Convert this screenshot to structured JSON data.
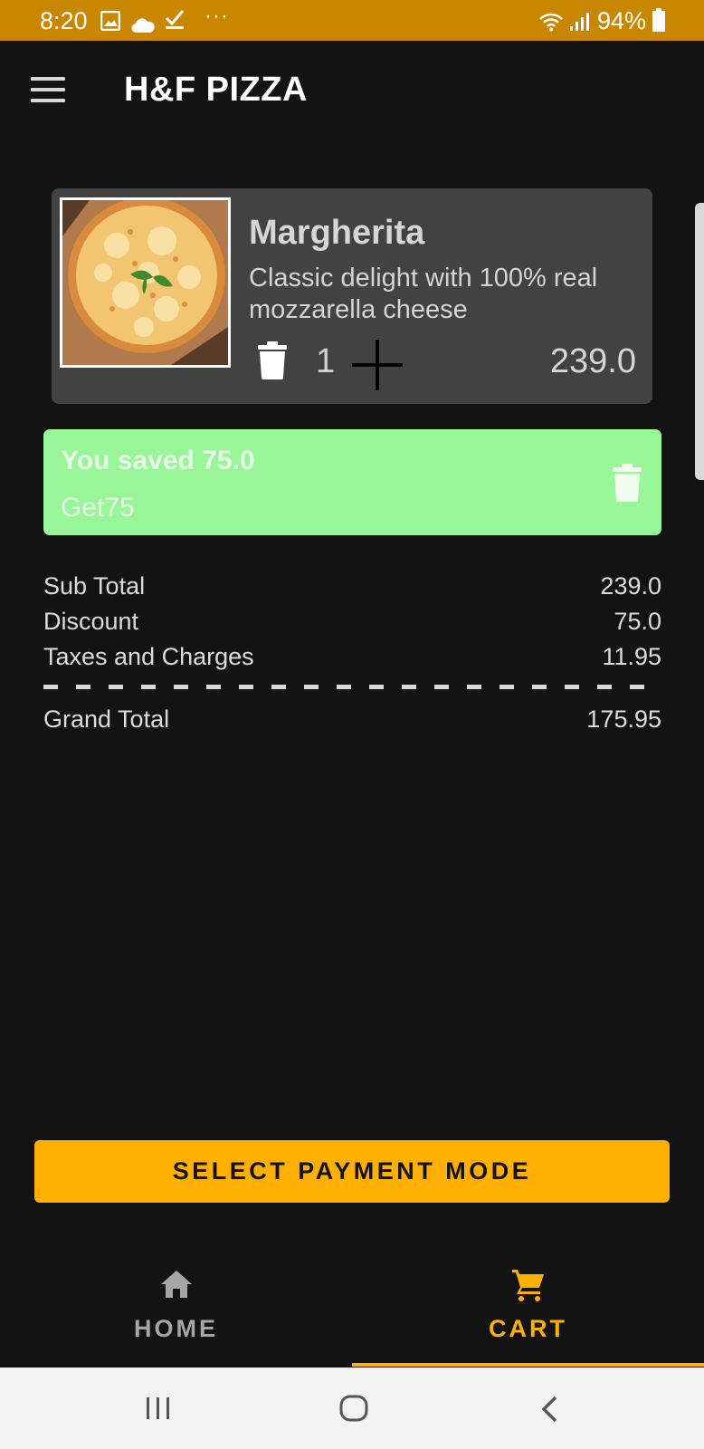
{
  "status_bar": {
    "time": "8:20",
    "battery": "94%",
    "dots": "···",
    "icons": [
      "image-icon",
      "cloud-icon",
      "download-done-icon",
      "wifi-icon",
      "signal-icon",
      "battery-icon"
    ]
  },
  "app_bar": {
    "title": "H&F PIZZA",
    "menu_icon": "menu-icon"
  },
  "cart_item": {
    "name": "Margherita",
    "description": "Classic delight with 100% real mozzarella cheese",
    "quantity": "1",
    "price": "239.0",
    "image": "margherita-pizza-image",
    "icons": [
      "trash-icon",
      "plus-icon"
    ]
  },
  "coupon": {
    "saved_text": "You saved 75.0",
    "code": "Get75",
    "icon": "trash-icon"
  },
  "summary": {
    "sub_total_label": "Sub Total",
    "sub_total_value": "239.0",
    "discount_label": "Discount",
    "discount_value": "75.0",
    "taxes_label": "Taxes and Charges",
    "taxes_value": "11.95",
    "grand_total_label": "Grand Total",
    "grand_total_value": "175.95"
  },
  "payment_button": {
    "label": "SELECT PAYMENT MODE"
  },
  "bottom_nav": {
    "items": [
      {
        "label": "HOME",
        "icon": "home-icon",
        "active": false
      },
      {
        "label": "CART",
        "icon": "cart-icon",
        "active": true
      }
    ]
  },
  "system_nav": {
    "icons": [
      "recent-apps-icon",
      "home-circle-icon",
      "back-icon"
    ]
  },
  "colors": {
    "background": "#131313",
    "status_bar": "#c98700",
    "accent": "#ffb000",
    "card": "#424242",
    "coupon": "#98f698"
  }
}
